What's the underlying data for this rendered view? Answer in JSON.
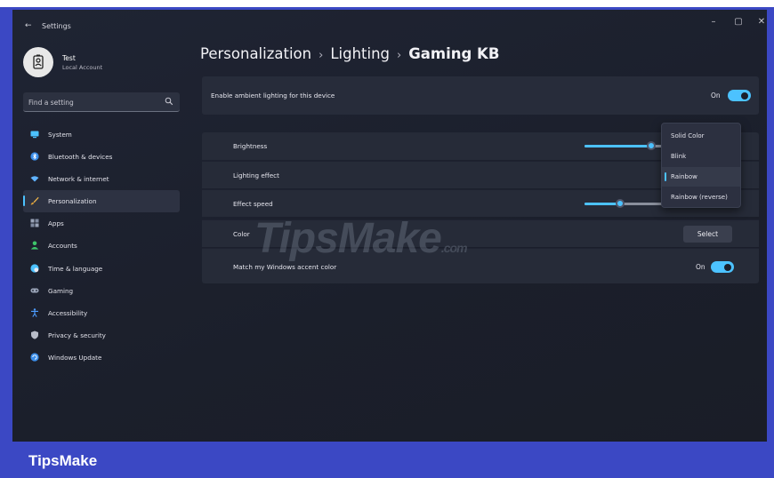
{
  "window": {
    "title": "Settings",
    "back_glyph": "←",
    "controls": {
      "minimize": "–",
      "maximize": "▢",
      "close": "✕"
    }
  },
  "user": {
    "name": "Test",
    "account_type": "Local Account"
  },
  "search": {
    "placeholder": "Find a setting"
  },
  "sidebar": {
    "items": [
      {
        "label": "System",
        "icon": "monitor-icon",
        "color": "#4cc2ff",
        "active": false
      },
      {
        "label": "Bluetooth & devices",
        "icon": "bluetooth-icon",
        "color": "#3b8eea",
        "active": false
      },
      {
        "label": "Network & internet",
        "icon": "wifi-icon",
        "color": "#5fb3ff",
        "active": false
      },
      {
        "label": "Personalization",
        "icon": "brush-icon",
        "color": "#e8b04a",
        "active": true
      },
      {
        "label": "Apps",
        "icon": "apps-icon",
        "color": "#9aa4b8",
        "active": false
      },
      {
        "label": "Accounts",
        "icon": "person-icon",
        "color": "#3dc46a",
        "active": false
      },
      {
        "label": "Time & language",
        "icon": "globe-clock-icon",
        "color": "#4cc2ff",
        "active": false
      },
      {
        "label": "Gaming",
        "icon": "gamepad-icon",
        "color": "#9aa4b8",
        "active": false
      },
      {
        "label": "Accessibility",
        "icon": "accessibility-icon",
        "color": "#4c9cff",
        "active": false
      },
      {
        "label": "Privacy & security",
        "icon": "shield-icon",
        "color": "#b8bcc8",
        "active": false
      },
      {
        "label": "Windows Update",
        "icon": "update-icon",
        "color": "#3b8eea",
        "active": false
      }
    ]
  },
  "breadcrumb": {
    "part1": "Personalization",
    "part2": "Lighting",
    "part3": "Gaming KB",
    "separator": "›"
  },
  "ambient": {
    "label": "Enable ambient lighting for this device",
    "state": "On"
  },
  "settings": {
    "brightness": {
      "label": "Brightness",
      "value": 0.85
    },
    "lighting_effect": {
      "label": "Lighting effect"
    },
    "effect_speed": {
      "label": "Effect speed",
      "value": 0.45
    },
    "color": {
      "label": "Color",
      "button": "Select"
    },
    "match_accent": {
      "label": "Match my Windows accent color",
      "state": "On"
    }
  },
  "dropdown": {
    "options": [
      "Solid Color",
      "Blink",
      "Rainbow",
      "Rainbow (reverse)"
    ],
    "selected": "Rainbow"
  },
  "watermark": {
    "text": "TipsMake",
    "suffix": ".com"
  },
  "footer": {
    "brand": "TipsMake"
  },
  "colors": {
    "accent": "#4cc2ff",
    "frame": "#3b48c4",
    "background": "#1c202b"
  }
}
